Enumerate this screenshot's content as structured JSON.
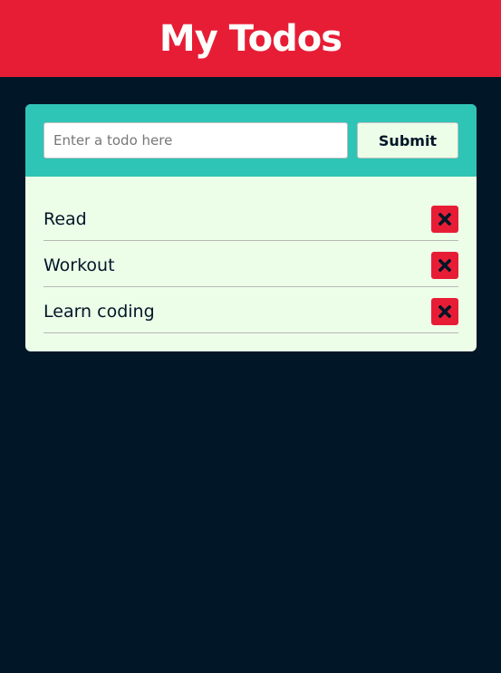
{
  "header": {
    "title": "My Todos"
  },
  "form": {
    "input_placeholder": "Enter a todo here",
    "input_value": "",
    "submit_label": "Submit"
  },
  "todos": [
    {
      "text": "Read",
      "delete_icon": "close-icon"
    },
    {
      "text": "Workout",
      "delete_icon": "close-icon"
    },
    {
      "text": "Learn coding",
      "delete_icon": "close-icon"
    }
  ],
  "colors": {
    "header_bg": "#E71D36",
    "page_bg": "#011627",
    "form_bg": "#2EC4B6",
    "list_bg": "#ECFEE8",
    "delete_bg": "#E71D36"
  }
}
